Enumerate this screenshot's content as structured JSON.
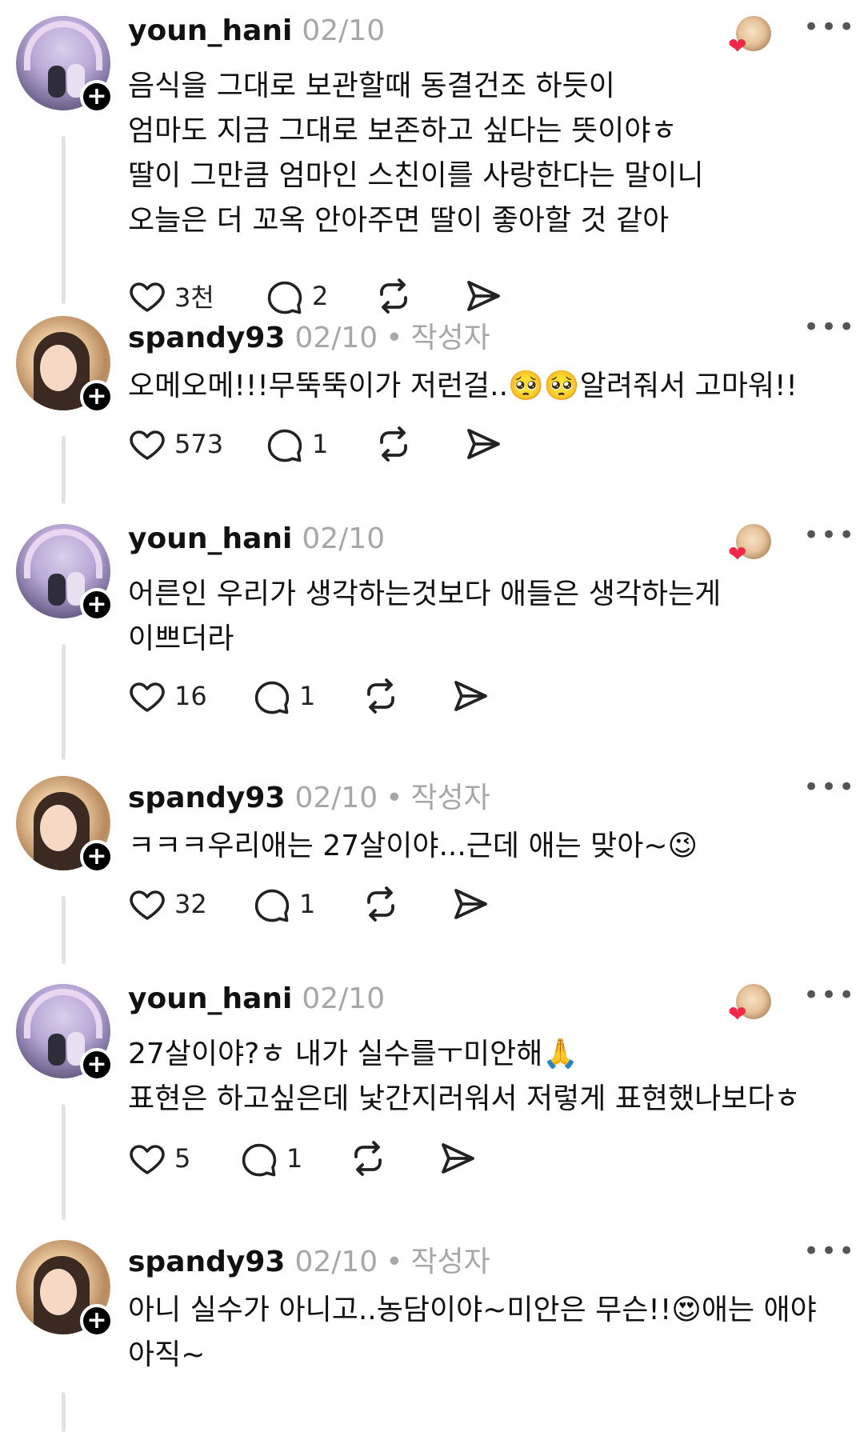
{
  "comments": [
    {
      "username": "youn_hani",
      "date": "02/10",
      "is_author": false,
      "lines": [
        "음식을 그대로 보관할때 동결건조 하듯이",
        "엄마도 지금 그대로 보존하고 싶다는 뜻이야ㅎ",
        "딸이 그만큼 엄마인 스친이를 사랑한다는 말이니",
        "오늘은 더 꼬옥 안아주면 딸이 좋아할 것 같아"
      ],
      "likes": "3천",
      "replies": "2",
      "author_liked": true
    },
    {
      "username": "spandy93",
      "date": "02/10",
      "is_author": true,
      "author_label": "작성자",
      "lines": [
        "오메오메!!!무뚝뚝이가  저런걸..🥺🥺알려줘서 고마워!!"
      ],
      "likes": "573",
      "replies": "1",
      "author_liked": false
    },
    {
      "username": "youn_hani",
      "date": "02/10",
      "is_author": false,
      "lines": [
        "어른인 우리가 생각하는것보다 애들은 생각하는게",
        "이쁘더라"
      ],
      "likes": "16",
      "replies": "1",
      "author_liked": true
    },
    {
      "username": "spandy93",
      "date": "02/10",
      "is_author": true,
      "author_label": "작성자",
      "lines": [
        "ㅋㅋㅋ우리애는 27살이야...근데 애는 맞아~😉"
      ],
      "likes": "32",
      "replies": "1",
      "author_liked": false
    },
    {
      "username": "youn_hani",
      "date": "02/10",
      "is_author": false,
      "lines": [
        "27살이야?ㅎ 내가 실수를ㅜ미안해🙏",
        "표현은 하고싶은데 낯간지러워서 저렇게 표현했나보다ㅎ"
      ],
      "likes": "5",
      "replies": "1",
      "author_liked": true
    },
    {
      "username": "spandy93",
      "date": "02/10",
      "is_author": true,
      "author_label": "작성자",
      "lines": [
        "아니 실수가 아니고..농담이야~미안은 무슨!!😍애는 애야",
        "아직~"
      ],
      "author_liked": false
    }
  ],
  "icons": {
    "like": "heart-outline-icon",
    "reply": "speech-bubble-icon",
    "repost": "repost-arrows-icon",
    "share": "paper-plane-icon",
    "more": "more-dots-icon",
    "follow": "plus-icon",
    "liked_by_author": "red-heart-icon"
  },
  "colors": {
    "text": "#111111",
    "muted": "#a7a7a7",
    "heart": "#f02849",
    "thread_line": "#e2e2e2"
  }
}
